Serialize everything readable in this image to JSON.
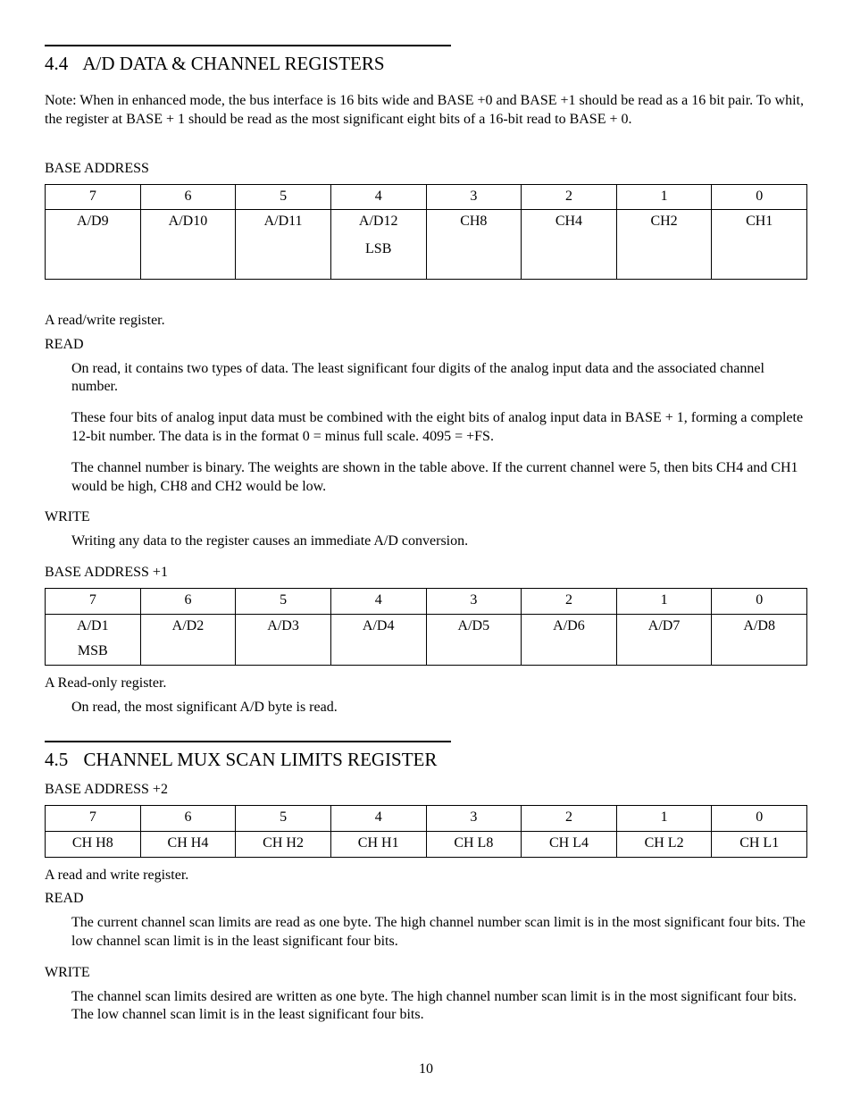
{
  "section44": {
    "num": "4.4",
    "title": "A/D DATA & CHANNEL REGISTERS",
    "note": "Note:  When in enhanced mode, the bus interface is 16 bits wide and BASE +0 and BASE +1 should be read as a 16 bit pair.  To whit, the register at BASE + 1 should be read as the most significant eight bits of a 16-bit read to BASE + 0.",
    "base_label": "BASE ADDRESS",
    "base_bits": [
      "7",
      "6",
      "5",
      "4",
      "3",
      "2",
      "1",
      "0"
    ],
    "base_cells": [
      "A/D9",
      "A/D10",
      "A/D11",
      "A/D12",
      "CH8",
      "CH4",
      "CH2",
      "CH1"
    ],
    "base_extra_idx3": "LSB",
    "rw_desc": "A read/write register.",
    "read_label": "READ",
    "read_p1": "On read, it contains two types of data. The least significant four digits of the analog input data and the associated channel number.",
    "read_p2": "These four bits of analog input data must be combined with the eight bits of analog input data in BASE + 1, forming a complete 12-bit number.  The data is in the format 0 = minus full scale.  4095 = +FS.",
    "read_p3": "The channel number is binary.  The weights are shown in the table above.  If the current channel were 5, then bits CH4 and CH1 would be high, CH8 and CH2 would be low.",
    "write_label": "WRITE",
    "write_p1": "Writing any data to the register causes an immediate A/D conversion.",
    "base1_label": "BASE ADDRESS +1",
    "base1_bits": [
      "7",
      "6",
      "5",
      "4",
      "3",
      "2",
      "1",
      "0"
    ],
    "base1_cells": [
      "A/D1",
      "A/D2",
      "A/D3",
      "A/D4",
      "A/D5",
      "A/D6",
      "A/D7",
      "A/D8"
    ],
    "base1_extra_idx0": "MSB",
    "ro_desc": "A Read-only register.",
    "ro_read": "On read, the most significant A/D byte is read."
  },
  "section45": {
    "num": "4.5",
    "title": "CHANNEL MUX SCAN LIMITS REGISTER",
    "base2_label": "BASE ADDRESS +2",
    "base2_bits": [
      "7",
      "6",
      "5",
      "4",
      "3",
      "2",
      "1",
      "0"
    ],
    "base2_cells": [
      "CH H8",
      "CH H4",
      "CH H2",
      "CH H1",
      "CH L8",
      "CH L4",
      "CH L2",
      "CH L1"
    ],
    "rw_desc": "A read and write register.",
    "read_label": "READ",
    "read_p1": "The current channel scan limits are read as one byte.  The high channel number scan limit is in the most significant four bits.  The low channel scan limit is in the least significant four bits.",
    "write_label": "WRITE",
    "write_p1": "The channel scan limits desired are written as one byte.  The high channel number scan limit is in the most significant four bits.  The low channel scan limit is in the least significant four bits."
  },
  "page_number": "10"
}
